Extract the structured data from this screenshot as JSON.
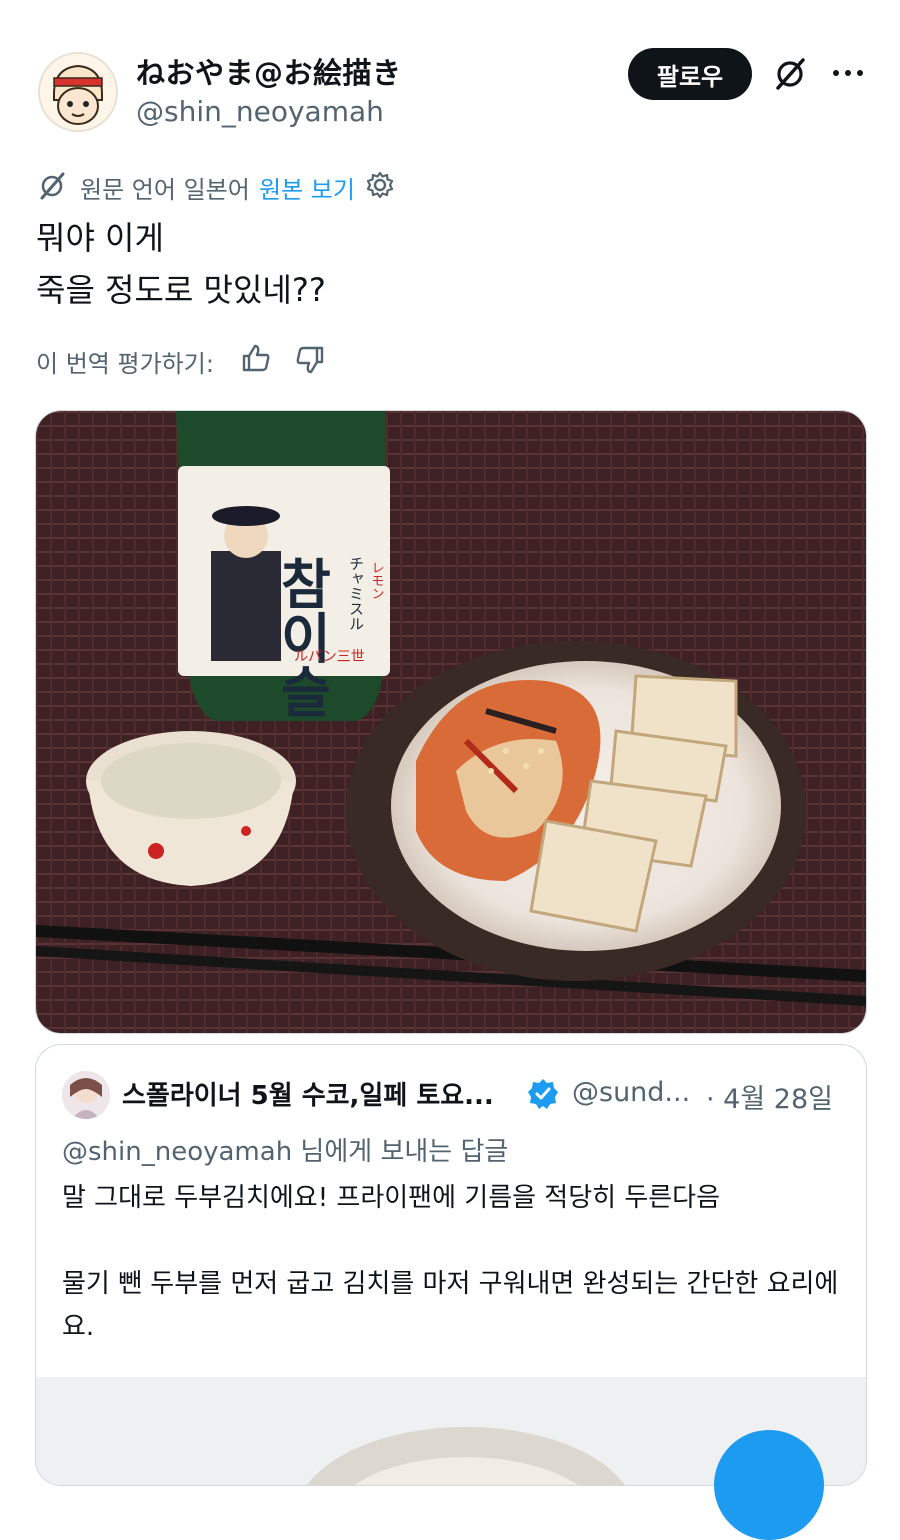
{
  "author": {
    "display_name": "ねおやま@お絵描き",
    "handle": "@shin_neoyamah",
    "follow_label": "팔로우"
  },
  "icons": {
    "grok": "grok-icon",
    "more": "more-icon",
    "translate": "translate-icon",
    "settings": "gear-icon",
    "thumbs_up": "thumbs-up-icon",
    "thumbs_down": "thumbs-down-icon",
    "verified": "verified-badge-icon"
  },
  "translation": {
    "source_label": "원문 언어 일본어",
    "show_original": "원본 보기",
    "rate_label": "이 번역 평가하기:"
  },
  "post": {
    "line1": "뭐야 이게",
    "line2": "죽을 정도로 맛있네??"
  },
  "photo": {
    "label_big": "참이슬",
    "label_kana": "チャミスル",
    "label_flavor": "レモン",
    "label_collab": "ルパン三世"
  },
  "quote": {
    "name": "스폴라이너 5월 수코,일페 토요...",
    "handle": "@sund...",
    "date": "· 4월 28일",
    "reply_to_handle": "@shin_neoyamah",
    "reply_suffix": " 님에게 보내는 답글",
    "text": "말 그대로 두부김치에요! 프라이팬에 기름을 적당히 두른다음\n\n물기 뺀 두부를 먼저 굽고 김치를 마저 구워내면 완성되는 간단한 요리에요."
  },
  "colors": {
    "accent": "#1d9bf0",
    "text_primary": "#0f1419",
    "text_secondary": "#536471",
    "border": "#cfd9de"
  }
}
